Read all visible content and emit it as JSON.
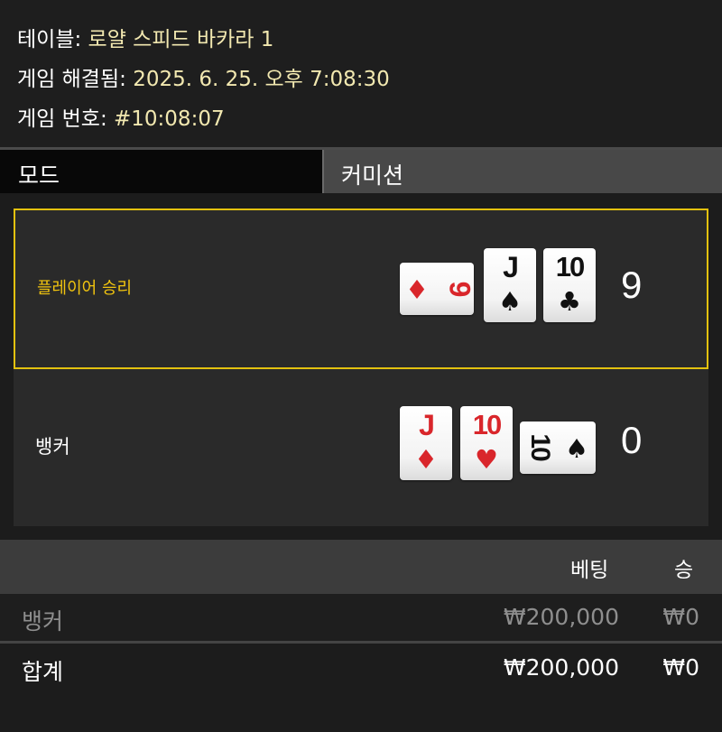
{
  "info": {
    "table_label": "테이블:",
    "table_value": "로얄 스피드 바카라 1",
    "resolved_label": "게임 해결됨:",
    "resolved_value": "2025. 6. 25. 오후 7:08:30",
    "game_no_label": "게임 번호:",
    "game_no_value": "#10:08:07"
  },
  "mode": {
    "label": "모드",
    "value": "커미션"
  },
  "hands": {
    "player": {
      "outcome": "플레이어 승리",
      "score": "9",
      "cards": [
        {
          "rank": "9",
          "suit": "♦",
          "color": "red",
          "orientation": "sideways"
        },
        {
          "rank": "J",
          "suit": "♠",
          "color": "black",
          "orientation": "upright"
        },
        {
          "rank": "10",
          "suit": "♣",
          "color": "black",
          "orientation": "upright"
        }
      ]
    },
    "banker": {
      "outcome": "뱅커",
      "score": "0",
      "cards": [
        {
          "rank": "J",
          "suit": "♦",
          "color": "red",
          "orientation": "upright"
        },
        {
          "rank": "10",
          "suit": "♥",
          "color": "red",
          "orientation": "upright"
        },
        {
          "rank": "10",
          "suit": "♠",
          "color": "black",
          "orientation": "sideways"
        }
      ]
    }
  },
  "bets": {
    "header": {
      "bet": "베팅",
      "win": "승"
    },
    "rows": [
      {
        "name": "뱅커",
        "bet": "₩200,000",
        "win": "₩0"
      }
    ],
    "total": {
      "name": "합계",
      "bet": "₩200,000",
      "win": "₩0"
    }
  },
  "colors": {
    "win_accent": "#f1c40f",
    "card_red": "#d9262b",
    "card_black": "#111111"
  }
}
